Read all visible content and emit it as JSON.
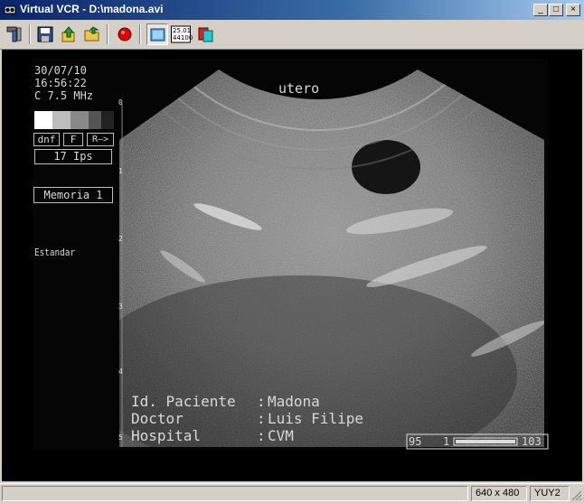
{
  "window": {
    "title": "Virtual VCR - D:\\madona.avi"
  },
  "title_buttons": {
    "minimize": "_",
    "maximize": "□",
    "close": "×"
  },
  "toolbar": {
    "tools": [
      "tools-icon",
      "save-icon",
      "upload-icon",
      "open-folder-icon",
      "record-icon",
      "capture-icon",
      "timecode-icon",
      "overlay-icon"
    ],
    "timecode_top": "25.01",
    "timecode_bottom": "44100"
  },
  "video": {
    "date": "30/07/10",
    "time": "16:56:22",
    "probe": "C 7.5 MHz",
    "buttons": [
      "dnf",
      "F",
      "R—>"
    ],
    "ips": "17 Ips",
    "memory": "Memoria 1",
    "preset": "Estandar",
    "organ": "utero",
    "patient": {
      "id_label": "Id. Paciente",
      "id_value": "Madona",
      "doctor_label": "Doctor",
      "doctor_value": "Luis Filipe",
      "hospital_label": "Hospital",
      "hospital_value": "CVM"
    },
    "frame_range": {
      "left": "95",
      "mid": "1",
      "right": "103"
    },
    "depth_marks": [
      "0",
      "1",
      "2",
      "3",
      "4",
      "5"
    ]
  },
  "status": {
    "resolution": "640 x 480",
    "format": "YUY2"
  },
  "colors": {
    "title_start": "#0a246a",
    "title_end": "#a6caf0",
    "chrome": "#d4d0c8",
    "record": "#e00000"
  }
}
